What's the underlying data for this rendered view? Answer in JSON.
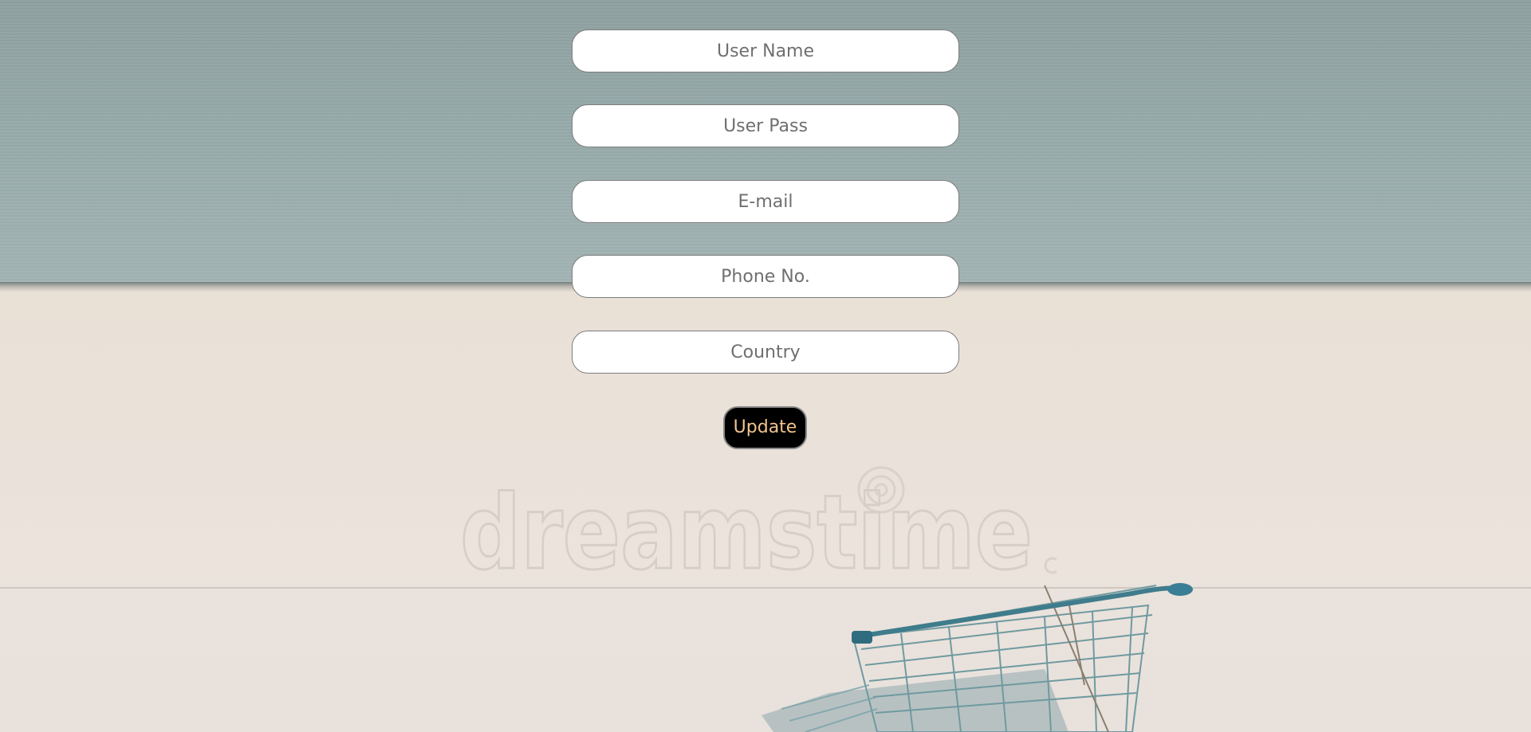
{
  "form": {
    "fields": [
      {
        "placeholder": "User Name",
        "value": ""
      },
      {
        "placeholder": "User Pass",
        "value": ""
      },
      {
        "placeholder": "E-mail",
        "value": ""
      },
      {
        "placeholder": "Phone No.",
        "value": ""
      },
      {
        "placeholder": "Country",
        "value": ""
      }
    ],
    "submit_label": "Update"
  },
  "background": {
    "watermark_text": "dreamstime",
    "description_colors": {
      "wall": "#97aaaa",
      "floor": "#ebe3dc",
      "button_bg": "#000000",
      "button_text": "#f2c48d"
    }
  }
}
